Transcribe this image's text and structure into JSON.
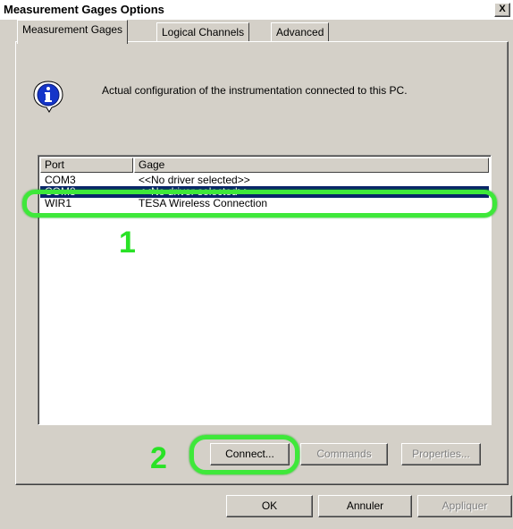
{
  "window": {
    "title": "Measurement Gages Options",
    "close_label": "X"
  },
  "tabs": [
    {
      "label": "Measurement Gages"
    },
    {
      "label": "Logical Channels"
    },
    {
      "label": "Advanced"
    }
  ],
  "info": {
    "icon": "info-icon",
    "text": "Actual configuration of the instrumentation connected to this PC."
  },
  "table": {
    "columns": [
      "Port",
      "Gage"
    ],
    "rows": [
      {
        "port": "COM3",
        "gage": "<<No driver selected>>"
      },
      {
        "port": "COM8",
        "gage": "<<No driver selected>>"
      },
      {
        "port": "WIR1",
        "gage": "TESA Wireless Connection"
      }
    ]
  },
  "buttons": {
    "connect": "Connect...",
    "commands": "Commands",
    "properties": "Properties...",
    "ok": "OK",
    "cancel": "Annuler",
    "apply": "Appliquer"
  },
  "annotations": {
    "step1": "1",
    "step2": "2",
    "color": "#3ee83a"
  },
  "colors": {
    "selection": "#0a246a",
    "face": "#d4d0c8"
  }
}
